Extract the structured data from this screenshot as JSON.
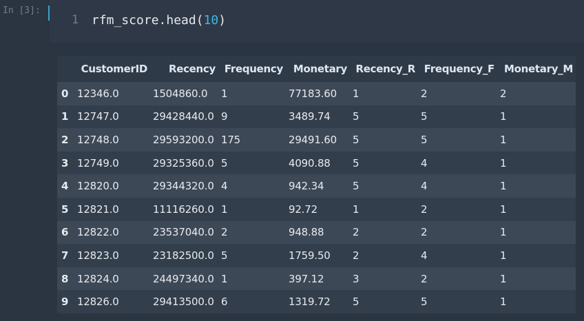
{
  "cell": {
    "prompt": "In [3]:",
    "line_number": "1",
    "code_prefix": "rfm_score.head(",
    "code_arg": "10",
    "code_suffix": ")"
  },
  "table": {
    "columns": [
      "",
      "CustomerID",
      "Recency",
      "Frequency",
      "Monetary",
      "Recency_R",
      "Frequency_F",
      "Monetary_M"
    ],
    "rows": [
      [
        "0",
        "12346.0",
        "1504860.0",
        "1",
        "77183.60",
        "1",
        "2",
        "2"
      ],
      [
        "1",
        "12747.0",
        "29428440.0",
        "9",
        "3489.74",
        "5",
        "5",
        "1"
      ],
      [
        "2",
        "12748.0",
        "29593200.0",
        "175",
        "29491.60",
        "5",
        "5",
        "1"
      ],
      [
        "3",
        "12749.0",
        "29325360.0",
        "5",
        "4090.88",
        "5",
        "4",
        "1"
      ],
      [
        "4",
        "12820.0",
        "29344320.0",
        "4",
        "942.34",
        "5",
        "4",
        "1"
      ],
      [
        "5",
        "12821.0",
        "11116260.0",
        "1",
        "92.72",
        "1",
        "2",
        "1"
      ],
      [
        "6",
        "12822.0",
        "23537040.0",
        "2",
        "948.88",
        "2",
        "2",
        "1"
      ],
      [
        "7",
        "12823.0",
        "23182500.0",
        "5",
        "1759.50",
        "2",
        "4",
        "1"
      ],
      [
        "8",
        "12824.0",
        "24497340.0",
        "1",
        "397.12",
        "3",
        "2",
        "1"
      ],
      [
        "9",
        "12826.0",
        "29413500.0",
        "6",
        "1319.72",
        "5",
        "5",
        "1"
      ]
    ]
  }
}
